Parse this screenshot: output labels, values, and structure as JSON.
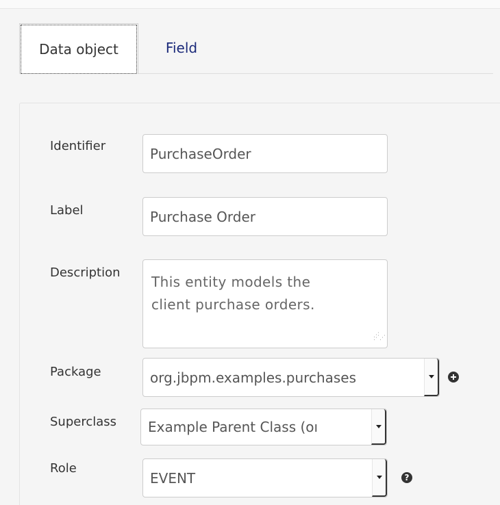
{
  "tabs": [
    {
      "label": "Data object",
      "active": true
    },
    {
      "label": "Field",
      "active": false
    }
  ],
  "form": {
    "identifier": {
      "label": "Identifier",
      "value": "PurchaseOrder"
    },
    "label": {
      "label": "Label",
      "value": "Purchase Order"
    },
    "description": {
      "label": "Description",
      "value": "This entity models the client purchase orders."
    },
    "package": {
      "label": "Package",
      "value": "org.jbpm.examples.purchases"
    },
    "superclass": {
      "label": "Superclass",
      "value": "Example Parent Class (oı"
    },
    "role": {
      "label": "Role",
      "value": "EVENT"
    }
  },
  "icons": {
    "package_action": "add-circle-icon",
    "role_help": "help-circle-icon",
    "select_caret": "chevron-down-icon",
    "textarea_grip": "resize-grip-icon"
  },
  "colors": {
    "tab_link": "#1b2a7a",
    "icon_dark": "#333333"
  }
}
